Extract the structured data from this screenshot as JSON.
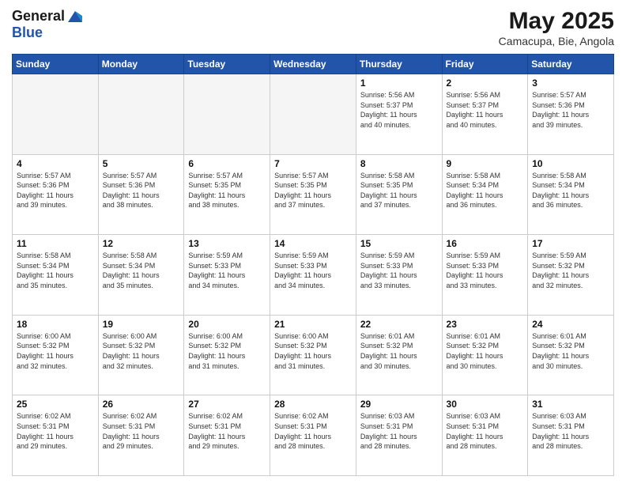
{
  "header": {
    "logo_line1": "General",
    "logo_line2": "Blue",
    "month": "May 2025",
    "location": "Camacupa, Bie, Angola"
  },
  "days_of_week": [
    "Sunday",
    "Monday",
    "Tuesday",
    "Wednesday",
    "Thursday",
    "Friday",
    "Saturday"
  ],
  "weeks": [
    [
      {
        "day": "",
        "info": ""
      },
      {
        "day": "",
        "info": ""
      },
      {
        "day": "",
        "info": ""
      },
      {
        "day": "",
        "info": ""
      },
      {
        "day": "1",
        "info": "Sunrise: 5:56 AM\nSunset: 5:37 PM\nDaylight: 11 hours\nand 40 minutes."
      },
      {
        "day": "2",
        "info": "Sunrise: 5:56 AM\nSunset: 5:37 PM\nDaylight: 11 hours\nand 40 minutes."
      },
      {
        "day": "3",
        "info": "Sunrise: 5:57 AM\nSunset: 5:36 PM\nDaylight: 11 hours\nand 39 minutes."
      }
    ],
    [
      {
        "day": "4",
        "info": "Sunrise: 5:57 AM\nSunset: 5:36 PM\nDaylight: 11 hours\nand 39 minutes."
      },
      {
        "day": "5",
        "info": "Sunrise: 5:57 AM\nSunset: 5:36 PM\nDaylight: 11 hours\nand 38 minutes."
      },
      {
        "day": "6",
        "info": "Sunrise: 5:57 AM\nSunset: 5:35 PM\nDaylight: 11 hours\nand 38 minutes."
      },
      {
        "day": "7",
        "info": "Sunrise: 5:57 AM\nSunset: 5:35 PM\nDaylight: 11 hours\nand 37 minutes."
      },
      {
        "day": "8",
        "info": "Sunrise: 5:58 AM\nSunset: 5:35 PM\nDaylight: 11 hours\nand 37 minutes."
      },
      {
        "day": "9",
        "info": "Sunrise: 5:58 AM\nSunset: 5:34 PM\nDaylight: 11 hours\nand 36 minutes."
      },
      {
        "day": "10",
        "info": "Sunrise: 5:58 AM\nSunset: 5:34 PM\nDaylight: 11 hours\nand 36 minutes."
      }
    ],
    [
      {
        "day": "11",
        "info": "Sunrise: 5:58 AM\nSunset: 5:34 PM\nDaylight: 11 hours\nand 35 minutes."
      },
      {
        "day": "12",
        "info": "Sunrise: 5:58 AM\nSunset: 5:34 PM\nDaylight: 11 hours\nand 35 minutes."
      },
      {
        "day": "13",
        "info": "Sunrise: 5:59 AM\nSunset: 5:33 PM\nDaylight: 11 hours\nand 34 minutes."
      },
      {
        "day": "14",
        "info": "Sunrise: 5:59 AM\nSunset: 5:33 PM\nDaylight: 11 hours\nand 34 minutes."
      },
      {
        "day": "15",
        "info": "Sunrise: 5:59 AM\nSunset: 5:33 PM\nDaylight: 11 hours\nand 33 minutes."
      },
      {
        "day": "16",
        "info": "Sunrise: 5:59 AM\nSunset: 5:33 PM\nDaylight: 11 hours\nand 33 minutes."
      },
      {
        "day": "17",
        "info": "Sunrise: 5:59 AM\nSunset: 5:32 PM\nDaylight: 11 hours\nand 32 minutes."
      }
    ],
    [
      {
        "day": "18",
        "info": "Sunrise: 6:00 AM\nSunset: 5:32 PM\nDaylight: 11 hours\nand 32 minutes."
      },
      {
        "day": "19",
        "info": "Sunrise: 6:00 AM\nSunset: 5:32 PM\nDaylight: 11 hours\nand 32 minutes."
      },
      {
        "day": "20",
        "info": "Sunrise: 6:00 AM\nSunset: 5:32 PM\nDaylight: 11 hours\nand 31 minutes."
      },
      {
        "day": "21",
        "info": "Sunrise: 6:00 AM\nSunset: 5:32 PM\nDaylight: 11 hours\nand 31 minutes."
      },
      {
        "day": "22",
        "info": "Sunrise: 6:01 AM\nSunset: 5:32 PM\nDaylight: 11 hours\nand 30 minutes."
      },
      {
        "day": "23",
        "info": "Sunrise: 6:01 AM\nSunset: 5:32 PM\nDaylight: 11 hours\nand 30 minutes."
      },
      {
        "day": "24",
        "info": "Sunrise: 6:01 AM\nSunset: 5:32 PM\nDaylight: 11 hours\nand 30 minutes."
      }
    ],
    [
      {
        "day": "25",
        "info": "Sunrise: 6:02 AM\nSunset: 5:31 PM\nDaylight: 11 hours\nand 29 minutes."
      },
      {
        "day": "26",
        "info": "Sunrise: 6:02 AM\nSunset: 5:31 PM\nDaylight: 11 hours\nand 29 minutes."
      },
      {
        "day": "27",
        "info": "Sunrise: 6:02 AM\nSunset: 5:31 PM\nDaylight: 11 hours\nand 29 minutes."
      },
      {
        "day": "28",
        "info": "Sunrise: 6:02 AM\nSunset: 5:31 PM\nDaylight: 11 hours\nand 28 minutes."
      },
      {
        "day": "29",
        "info": "Sunrise: 6:03 AM\nSunset: 5:31 PM\nDaylight: 11 hours\nand 28 minutes."
      },
      {
        "day": "30",
        "info": "Sunrise: 6:03 AM\nSunset: 5:31 PM\nDaylight: 11 hours\nand 28 minutes."
      },
      {
        "day": "31",
        "info": "Sunrise: 6:03 AM\nSunset: 5:31 PM\nDaylight: 11 hours\nand 28 minutes."
      }
    ]
  ]
}
